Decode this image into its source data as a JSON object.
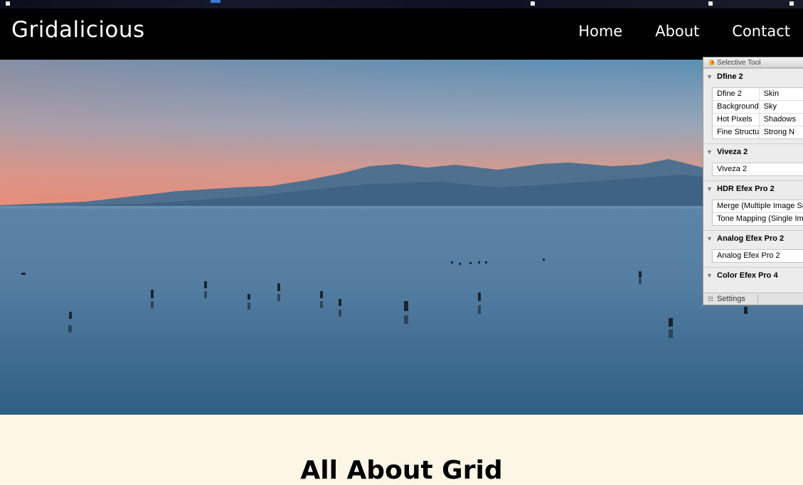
{
  "site": {
    "brand": "Gridalicious",
    "nav": [
      "Home",
      "About",
      "Contact"
    ]
  },
  "hero": {
    "image": "sunset-lake-with-herons"
  },
  "section": {
    "title": "All About Grid"
  },
  "panel": {
    "title": "Selective Tool",
    "sections": [
      {
        "name": "Dfine 2",
        "rows": [
          [
            "Dfine 2",
            "Skin"
          ],
          [
            "Background",
            "Sky"
          ],
          [
            "Hot Pixels",
            "Shadows"
          ],
          [
            "Fine Structu...",
            "Strong N"
          ]
        ]
      },
      {
        "name": "Viveza 2",
        "rows": [
          [
            "Viveza 2"
          ]
        ]
      },
      {
        "name": "HDR Efex Pro 2",
        "rows": [
          [
            "Merge (Multiple Image Se"
          ],
          [
            "Tone Mapping (Single Im"
          ]
        ]
      },
      {
        "name": "Analog Efex Pro 2",
        "rows": [
          [
            "Analog Efex Pro 2"
          ]
        ]
      },
      {
        "name": "Color Efex Pro 4",
        "rows": []
      }
    ],
    "settings_label": "Settings"
  },
  "colors": {
    "nav_bg": "#000000",
    "page_bg": "#fdf6e6",
    "sky_top": "#5a8fb3",
    "sky_horizon": "#e88b78",
    "water": "#3d6f92"
  }
}
